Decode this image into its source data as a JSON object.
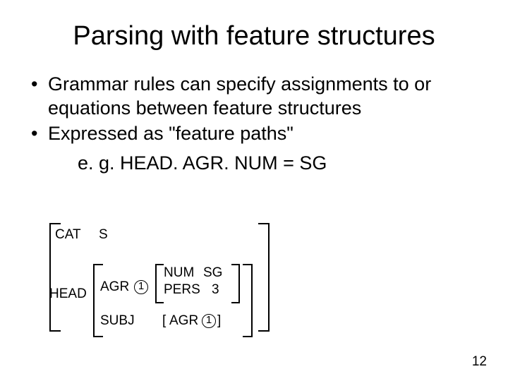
{
  "title": "Parsing with feature structures",
  "bullets": [
    "Grammar rules can specify assignments to or equations between feature structures",
    "Expressed as \"feature paths\""
  ],
  "example": "e. g. HEAD. AGR. NUM = SG",
  "fs": {
    "cat_label": "CAT",
    "cat_value": "S",
    "head_label": "HEAD",
    "agr_label": "AGR",
    "tag": "1",
    "num_label": "NUM",
    "num_value": "SG",
    "pers_label": "PERS",
    "pers_value": "3",
    "subj_label": "SUBJ",
    "subj_agr": "AGR",
    "subj_open": "[",
    "subj_close": "]"
  },
  "page_number": "12"
}
